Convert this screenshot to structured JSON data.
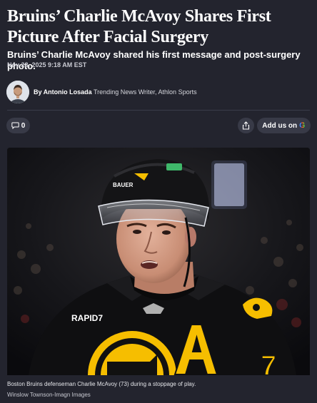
{
  "article": {
    "headline": "Bruins’ Charlie McAvoy Shares First Picture After Facial Surgery",
    "subtitle": "Bruins’ Charlie McAvoy shared his first message and post-surgery photo.",
    "date": "Nov 28, 2025 9:18 AM EST"
  },
  "author": {
    "by_label": "By Antonio Losada",
    "role": "Trending News Writer, Athlon Sports"
  },
  "actions": {
    "comment_count": "0",
    "add_us_label": "Add us on",
    "google_letter": "G"
  },
  "image": {
    "caption": "Boston Bruins defenseman Charlie McAvoy (73) during a stoppage of play.",
    "credit": "Winslow Townson-Imagn Images",
    "helmet_brand": "BAUER",
    "jersey_sponsor": "RAPID7",
    "captain_letter": "A",
    "jersey_number": "7"
  },
  "colors": {
    "background": "#23242e",
    "pill": "#383a47",
    "jersey_gold": "#f6be00"
  },
  "icons": {
    "comment": "comment-bubble-icon",
    "share": "share-icon",
    "google": "google-g-icon"
  }
}
